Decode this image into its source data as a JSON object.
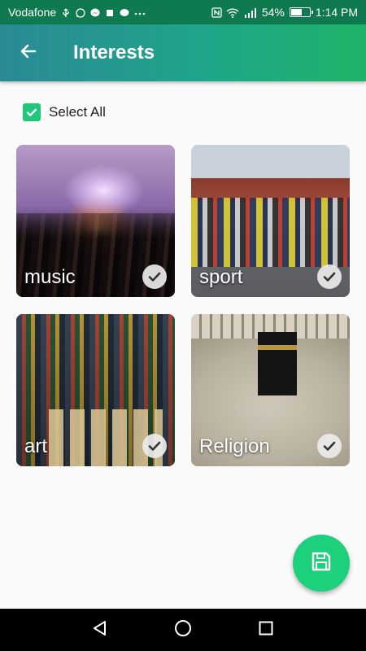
{
  "status_bar": {
    "carrier": "Vodafone",
    "battery": "54%",
    "battery_level": 0.54,
    "time": "1:14 PM",
    "icons": [
      "usb-icon",
      "whatsapp-icon",
      "messenger-icon",
      "stop-icon",
      "chat-icon",
      "more-icon",
      "nfc-icon",
      "wifi-icon",
      "signal-icon",
      "battery-icon"
    ]
  },
  "app_bar": {
    "title": "Interests",
    "back_icon": "arrow-left-icon"
  },
  "select_all": {
    "label": "Select All",
    "checked": true
  },
  "interests": [
    {
      "label": "music",
      "checked": true
    },
    {
      "label": "sport",
      "checked": true
    },
    {
      "label": "art",
      "checked": true
    },
    {
      "label": "Religion",
      "checked": true
    }
  ],
  "fab": {
    "icon": "save-icon"
  },
  "nav_bar": {
    "icons": [
      "back-triangle-icon",
      "home-circle-icon",
      "recents-square-icon"
    ]
  },
  "colors": {
    "status_bar": "#0f7a4f",
    "app_bar_start": "#2a8a96",
    "app_bar_end": "#1fb46a",
    "accent": "#1ec77a",
    "fab": "#1dd07c"
  }
}
